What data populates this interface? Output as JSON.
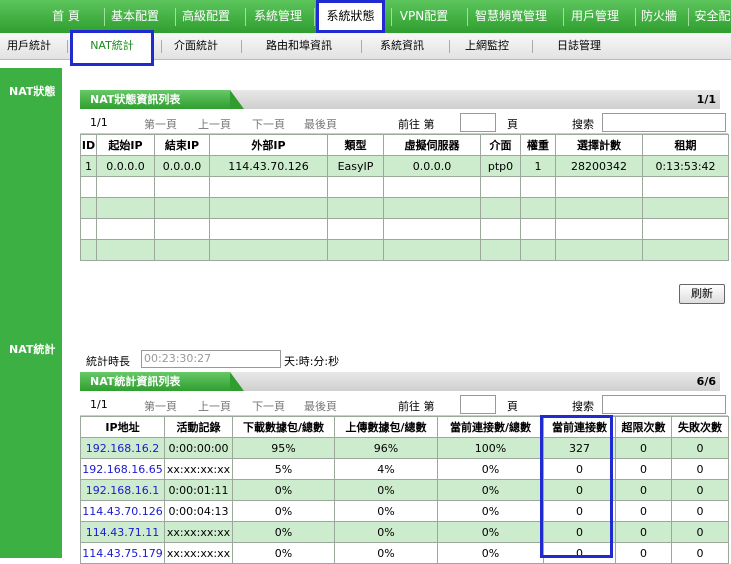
{
  "top_nav": [
    "首 頁",
    "基本配置",
    "高級配置",
    "系統管理",
    "系統狀態",
    "VPN配置",
    "智慧頻寬管理",
    "用戶管理",
    "防火牆",
    "安全配"
  ],
  "sub_nav": [
    "用戶統計",
    "NAT統計",
    "介面統計",
    "路由和埠資訊",
    "系統資訊",
    "上網監控",
    "日誌管理"
  ],
  "sidebar": {
    "nat_status": "NAT狀態",
    "nat_stats": "NAT統計"
  },
  "nat_status_panel": {
    "title": "NAT狀態資訊列表",
    "page": "1/1",
    "pager": {
      "current": "1/1",
      "first": "第一頁",
      "prev": "上一頁",
      "next": "下一頁",
      "last": "最後頁",
      "goto": "前往 第",
      "page_unit": "頁",
      "search": "搜索"
    },
    "columns": [
      "ID",
      "起始IP",
      "結束IP",
      "外部IP",
      "類型",
      "虛擬伺服器",
      "介面",
      "權重",
      "選擇計數",
      "租期"
    ],
    "rows": [
      [
        "1",
        "0.0.0.0",
        "0.0.0.0",
        "114.43.70.126",
        "EasyIP",
        "0.0.0.0",
        "ptp0",
        "1",
        "28200342",
        "0:13:53:42"
      ]
    ]
  },
  "refresh_button": "刷新",
  "duration": {
    "label": "統計時長",
    "value": "00:23:30:27",
    "unit": "天:時:分:秒"
  },
  "nat_stats_panel": {
    "title": "NAT統計資訊列表",
    "page": "6/6",
    "pager": {
      "current": "1/1",
      "first": "第一頁",
      "prev": "上一頁",
      "next": "下一頁",
      "last": "最後頁",
      "goto": "前往 第",
      "page_unit": "頁",
      "search": "搜索"
    },
    "columns": [
      "IP地址",
      "活動記錄",
      "下載數據包/總數",
      "上傳數據包/總數",
      "當前連接數/總數",
      "當前連接數",
      "超限次數",
      "失敗次數"
    ],
    "rows": [
      [
        "192.168.16.2",
        "0:00:00:00",
        "95%",
        "96%",
        "100%",
        "327",
        "0",
        "0"
      ],
      [
        "192.168.16.65",
        "xx:xx:xx:xx",
        "5%",
        "4%",
        "0%",
        "0",
        "0",
        "0"
      ],
      [
        "192.168.16.1",
        "0:00:01:11",
        "0%",
        "0%",
        "0%",
        "0",
        "0",
        "0"
      ],
      [
        "114.43.70.126",
        "0:00:04:13",
        "0%",
        "0%",
        "0%",
        "0",
        "0",
        "0"
      ],
      [
        "114.43.71.11",
        "xx:xx:xx:xx",
        "0%",
        "0%",
        "0%",
        "0",
        "0",
        "0"
      ],
      [
        "114.43.75.179",
        "xx:xx:xx:xx",
        "0%",
        "0%",
        "0%",
        "0",
        "0",
        "0"
      ]
    ]
  }
}
